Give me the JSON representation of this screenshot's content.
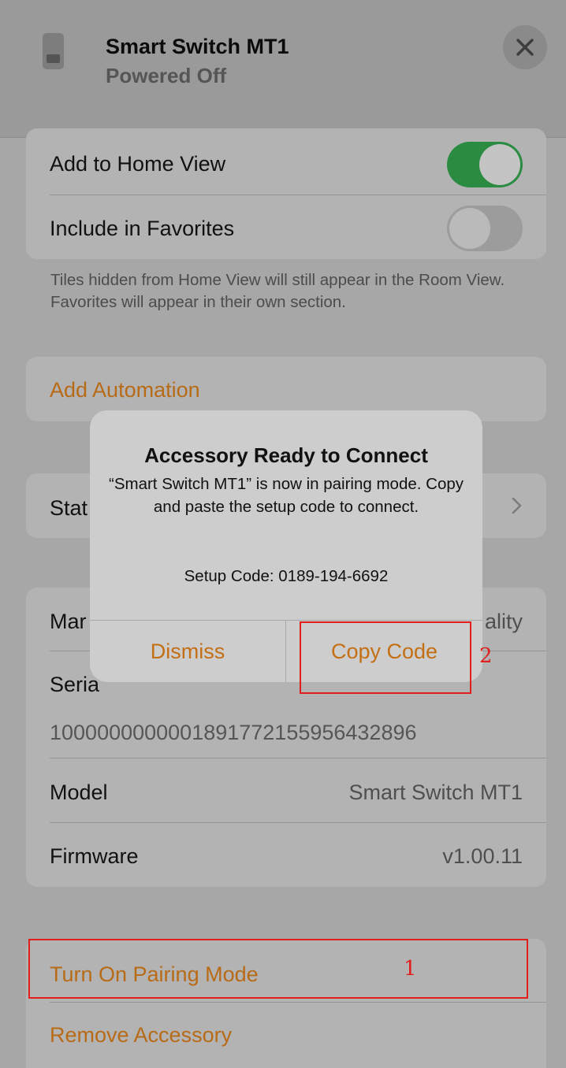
{
  "header": {
    "title": "Smart Switch MT1",
    "status": "Powered Off",
    "close_icon": "close-icon",
    "device_icon": "switch-icon"
  },
  "toggles": [
    {
      "label": "Add to Home View",
      "on": true
    },
    {
      "label": "Include in Favorites",
      "on": false
    }
  ],
  "footnote": "Tiles hidden from Home View will still appear in the Room View. Favorites will appear in their own section.",
  "automation": {
    "label": "Add Automation"
  },
  "status_row": {
    "label_visible": "Stat",
    "chevron": "chevron-right-icon"
  },
  "info": {
    "manufacturer_label_visible": "Mar",
    "manufacturer_value_visible": "ality",
    "serial_label_visible": "Seria",
    "serial_value": "100000000000189177215595643289​6",
    "model_label": "Model",
    "model_value": "Smart Switch MT1",
    "firmware_label": "Firmware",
    "firmware_value": "v1.00.11"
  },
  "actions": {
    "pairing": "Turn On Pairing Mode",
    "remove": "Remove Accessory"
  },
  "dialog": {
    "title": "Accessory Ready to Connect",
    "message": "“Smart Switch MT1” is now in pairing mode. Copy and paste the setup code to connect.",
    "setup_code": "Setup Code: 0189-194-6692",
    "dismiss": "Dismiss",
    "copy": "Copy Code"
  },
  "annotations": {
    "first": "1",
    "second": "2"
  },
  "colors": {
    "accent": "#b86b17",
    "toggle_on": "#2a8b41",
    "annotation": "#e11d1d"
  }
}
